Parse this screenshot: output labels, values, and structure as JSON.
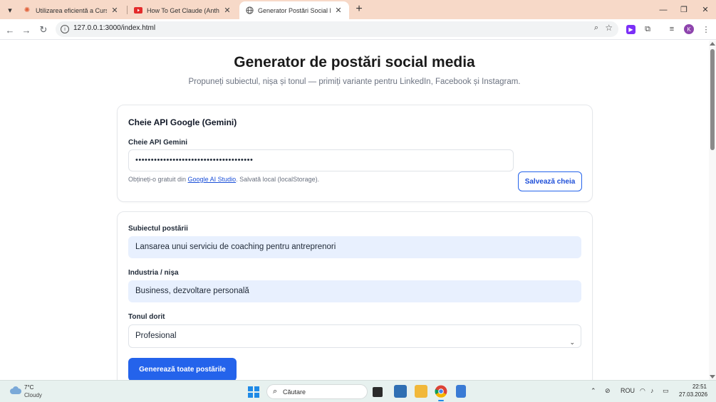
{
  "browser": {
    "tabs": [
      {
        "title": "Utilizarea eficientă a CursorAI -",
        "favicon": "sparkle-icon",
        "active": false
      },
      {
        "title": "How To Get Claude (Anthropic)",
        "favicon": "youtube-icon",
        "active": false
      },
      {
        "title": "Generator Postări Social Media",
        "favicon": "globe-icon",
        "active": true
      }
    ],
    "url": "127.0.0.1:3000/index.html",
    "profile_initial": "K"
  },
  "page": {
    "title": "Generator de postări social media",
    "subtitle": "Propuneți subiectul, nișa și tonul — primiți variante pentru LinkedIn, Facebook și Instagram."
  },
  "api_card": {
    "heading": "Cheie API Google (Gemini)",
    "label": "Cheie API Gemini",
    "value": "••••••••••••••••••••••••••••••••••••••",
    "hint_prefix": "Obțineți-o gratuit din ",
    "hint_link": "Google AI Studio",
    "hint_suffix": ". Salvată local (localStorage).",
    "save_button": "Salvează cheia"
  },
  "form": {
    "subject_label": "Subiectul postării",
    "subject_value": "Lansarea unui serviciu de coaching pentru antreprenori",
    "industry_label": "Industria / nișa",
    "industry_value": "Business, dezvoltare personală",
    "tone_label": "Tonul dorit",
    "tone_value": "Profesional",
    "generate_button": "Generează toate postările"
  },
  "taskbar": {
    "temperature": "7°C",
    "weather": "Cloudy",
    "search_placeholder": "Căutare",
    "language": "ROU",
    "time": "22:51",
    "date": "27.03.2026"
  },
  "colors": {
    "primary": "#2463eb",
    "tab_strip": "#f7d9c8",
    "filled_input": "#e8f0fe",
    "taskbar": "#e7f1ef"
  }
}
